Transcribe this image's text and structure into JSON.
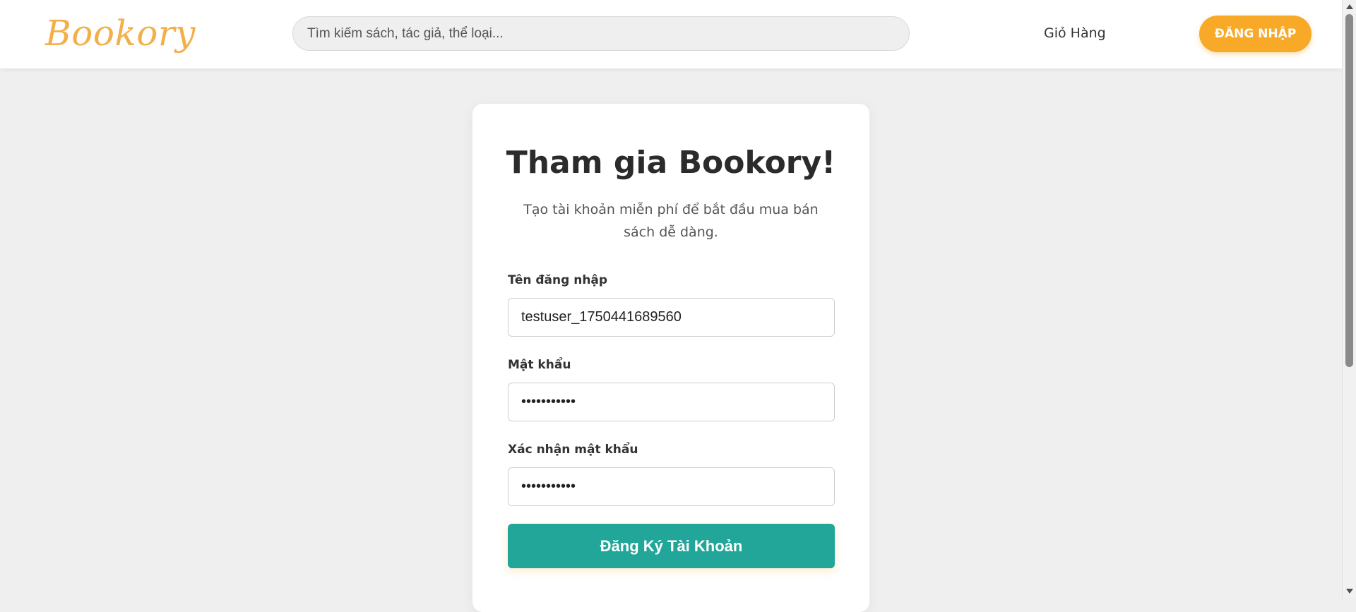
{
  "header": {
    "logo": "Bookory",
    "search_placeholder": "Tìm kiếm sách, tác giả, thể loại...",
    "cart_label": "Giỏ Hàng",
    "login_label": "ĐĂNG NHẬP"
  },
  "register": {
    "title": "Tham gia Bookory!",
    "subtitle": "Tạo tài khoản miễn phí để bắt đầu mua bán sách dễ dàng.",
    "username_label": "Tên đăng nhập",
    "username_value": "testuser_1750441689560",
    "password_label": "Mật khẩu",
    "password_value": "password123",
    "confirm_label": "Xác nhận mật khẩu",
    "confirm_value": "password123",
    "submit_label": "Đăng Ký Tài Khoản"
  },
  "colors": {
    "brand": "#f3b04a",
    "login_button": "#f8a928",
    "submit_button": "#22a699",
    "page_background": "#efefef"
  }
}
